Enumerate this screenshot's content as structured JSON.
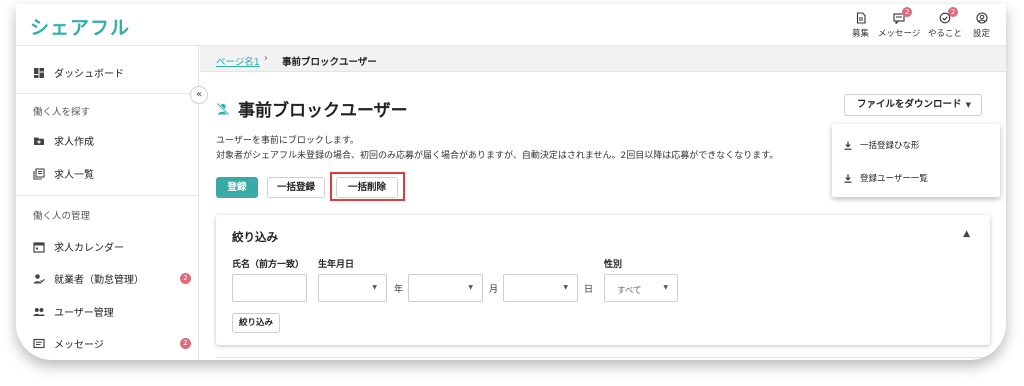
{
  "app": {
    "logo": "シェアフル"
  },
  "topnav": [
    {
      "label": "募集",
      "icon": "document-icon",
      "badge": ""
    },
    {
      "label": "メッセージ",
      "icon": "message-icon",
      "badge": "2"
    },
    {
      "label": "やること",
      "icon": "check-icon",
      "badge": "2"
    },
    {
      "label": "設定",
      "icon": "user-icon",
      "badge": ""
    }
  ],
  "sidebar": {
    "dashboard": "ダッシュボード",
    "section1": "働く人を探す",
    "job_create": "求人作成",
    "job_list": "求人一覧",
    "section2": "働く人の管理",
    "calendar": "求人カレンダー",
    "workers": "就業者（勤怠管理）",
    "workers_badge": "2",
    "users": "ユーザー管理",
    "messages": "メッセージ",
    "messages_badge": "2",
    "collapse": "«"
  },
  "breadcrumb": {
    "parent": "ページ名1",
    "separator": "›",
    "current": "事前ブロックユーザー"
  },
  "page": {
    "title": "事前ブロックユーザー",
    "desc1": "ユーザーを事前にブロックします。",
    "desc2": "対象者がシェアフル未登録の場合、初回のみ応募が届く場合がありますが、自動決定はされません。2回目以降は応募ができなくなります。",
    "btn_register": "登録",
    "btn_bulk_register": "一括登録",
    "btn_bulk_delete": "一括削除"
  },
  "download": {
    "label": "ファイルをダウンロード",
    "items": [
      "一括登録ひな形",
      "登録ユーザー一覧"
    ]
  },
  "filter": {
    "title": "絞り込み",
    "name_label": "氏名（前方一致）",
    "birth_label": "生年月日",
    "year_unit": "年",
    "month_unit": "月",
    "day_unit": "日",
    "gender_label": "性別",
    "gender_value": "すべて",
    "submit": "絞り込み"
  },
  "colors": {
    "accent": "#2fb0a8",
    "badge": "#e0697a",
    "highlight": "#e0393e"
  }
}
